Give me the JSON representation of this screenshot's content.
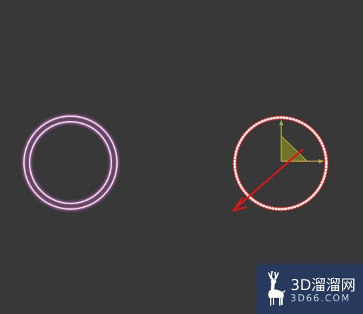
{
  "viewport": {
    "background_color": "#383838"
  },
  "objects": [
    {
      "name": "left-ring",
      "kind": "double circle outline",
      "color": "#f5c6f2",
      "glow_color": "#b46fb0",
      "selected": false
    },
    {
      "name": "right-ring",
      "kind": "circle outline",
      "color": "#ff2b2b",
      "selected": true
    }
  ],
  "gizmo": {
    "type": "move",
    "x_axis_color": "#c8a24a",
    "y_axis_color": "#9ab542",
    "z_axis_color": "#e01515",
    "plane_handle_color": "#8a8a2a",
    "x_label": "x",
    "y_label": "y"
  },
  "watermark": {
    "title": "3D溜溜网",
    "url": "3D66.COM",
    "background_color": "#273a5e",
    "logo_icon": "deer-icon"
  }
}
